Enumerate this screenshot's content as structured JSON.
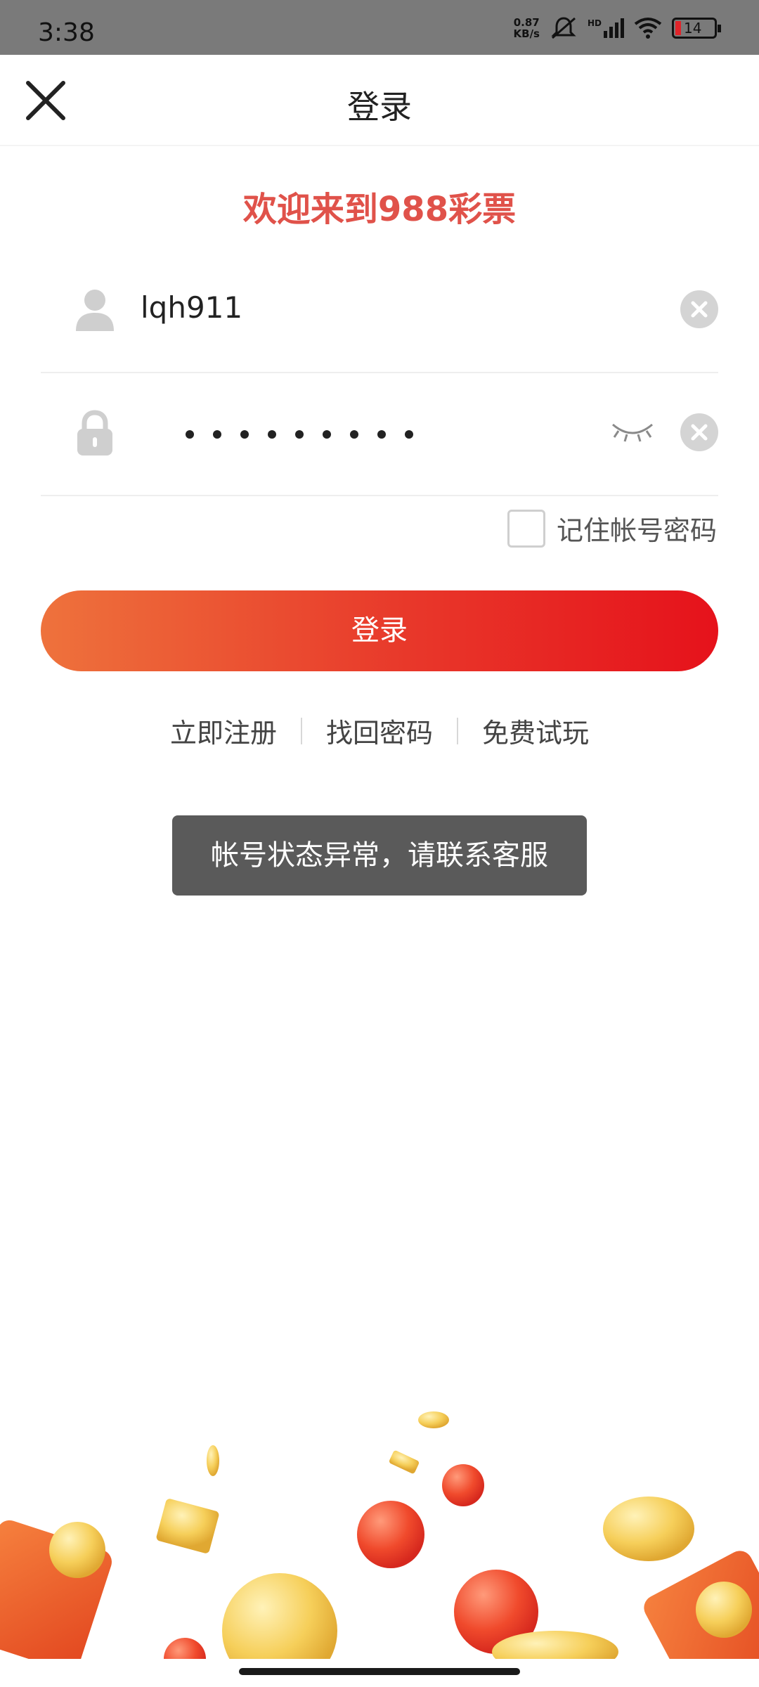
{
  "status_bar": {
    "time": "3:38",
    "net_speed_value": "0.87",
    "net_speed_unit": "KB/s",
    "signal_label": "HD",
    "battery": "14",
    "icons": [
      "net-speed-icon",
      "mute-icon",
      "signal-icon",
      "wifi-icon",
      "battery-icon"
    ]
  },
  "header": {
    "title": "登录",
    "close_icon": "close-icon"
  },
  "welcome": "欢迎来到988彩票",
  "form": {
    "username": {
      "value": "lqh911",
      "icon": "user-icon"
    },
    "password": {
      "masked_length": 9,
      "icon": "lock-icon",
      "visibility_icon": "eye-closed-icon"
    },
    "remember_label": "记住帐号密码",
    "remember_checked": false
  },
  "login_button": "登录",
  "links": {
    "register": "立即注册",
    "recover": "找回密码",
    "trial": "免费试玩"
  },
  "toast": "帐号状态异常，请联系客服",
  "colors": {
    "accent": "#e0524a",
    "button_start": "#ee723c",
    "button_end": "#e6121b",
    "toast_bg": "#5a5a5a"
  }
}
